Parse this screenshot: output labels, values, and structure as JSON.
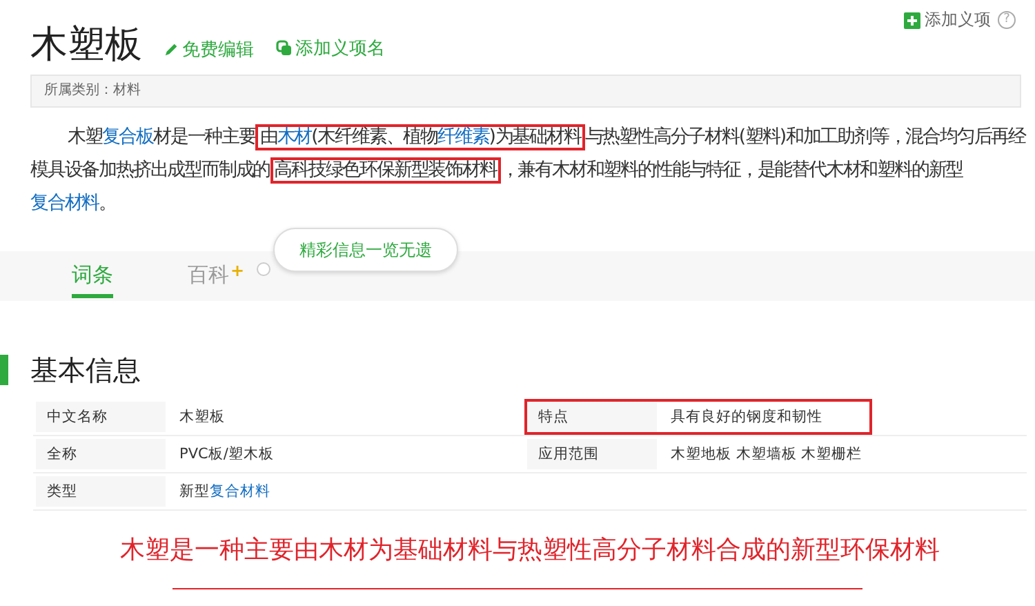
{
  "header": {
    "title": "木塑板",
    "actions": [
      {
        "kind": "edit",
        "label": "免费编辑"
      },
      {
        "kind": "add",
        "label": "添加义项名"
      }
    ],
    "corner_action": {
      "label": "添加义项",
      "help": "?"
    }
  },
  "category": "所属类别：材料",
  "summary": [
    {
      "kind": "text",
      "text": "木塑"
    },
    {
      "kind": "link",
      "text": "复合板"
    },
    {
      "kind": "text",
      "text": "材是一种主要"
    },
    {
      "kind": "highlight",
      "parts": [
        {
          "kind": "text",
          "text": "由"
        },
        {
          "kind": "link",
          "text": "木材"
        },
        {
          "kind": "text",
          "text": "(木纤维素、植物"
        },
        {
          "kind": "link",
          "text": "纤维素"
        },
        {
          "kind": "text",
          "text": ")为基础材料"
        }
      ]
    },
    {
      "kind": "text",
      "text": "与热塑性高分子材料(塑料)和加工助剂等，混合均匀后再经模具设备加热挤出成型而制成的"
    },
    {
      "kind": "highlight",
      "parts": [
        {
          "kind": "text",
          "text": "高科技绿色环保新型装饰材料"
        }
      ]
    },
    {
      "kind": "text",
      "text": "，兼有木材和塑料的性能与特征，是能替代木材和塑料的新型"
    },
    {
      "kind": "link",
      "text": "复合材料"
    },
    {
      "kind": "text",
      "text": "。"
    }
  ],
  "tabs": [
    {
      "label": "词条",
      "selected": true
    },
    {
      "label": "百科",
      "selected": false,
      "badge": "+"
    }
  ],
  "tooltip": "精彩信息一览无遗",
  "section_title": "基本信息",
  "info_rows": [
    [
      {
        "label": "中文名称",
        "value": [
          {
            "kind": "text",
            "text": "木塑板"
          }
        ],
        "highlighted": false
      },
      {
        "label": "特点",
        "value": [
          {
            "kind": "text",
            "text": "具有良好的钢度和韧性"
          }
        ],
        "highlighted": true
      }
    ],
    [
      {
        "label": "全称",
        "value": [
          {
            "kind": "text",
            "text": "PVC板/塑木板"
          }
        ],
        "highlighted": false
      },
      {
        "label": "应用范围",
        "value": [
          {
            "kind": "text",
            "text": "木塑地板 木塑墙板 木塑栅栏"
          }
        ],
        "highlighted": false
      }
    ],
    [
      {
        "label": "类型",
        "value": [
          {
            "kind": "text",
            "text": "新型"
          },
          {
            "kind": "link",
            "text": "复合材料"
          }
        ],
        "highlighted": false
      }
    ]
  ],
  "caption": "木塑是一种主要由木材为基础材料与热塑性高分子材料合成的新型环保材料"
}
